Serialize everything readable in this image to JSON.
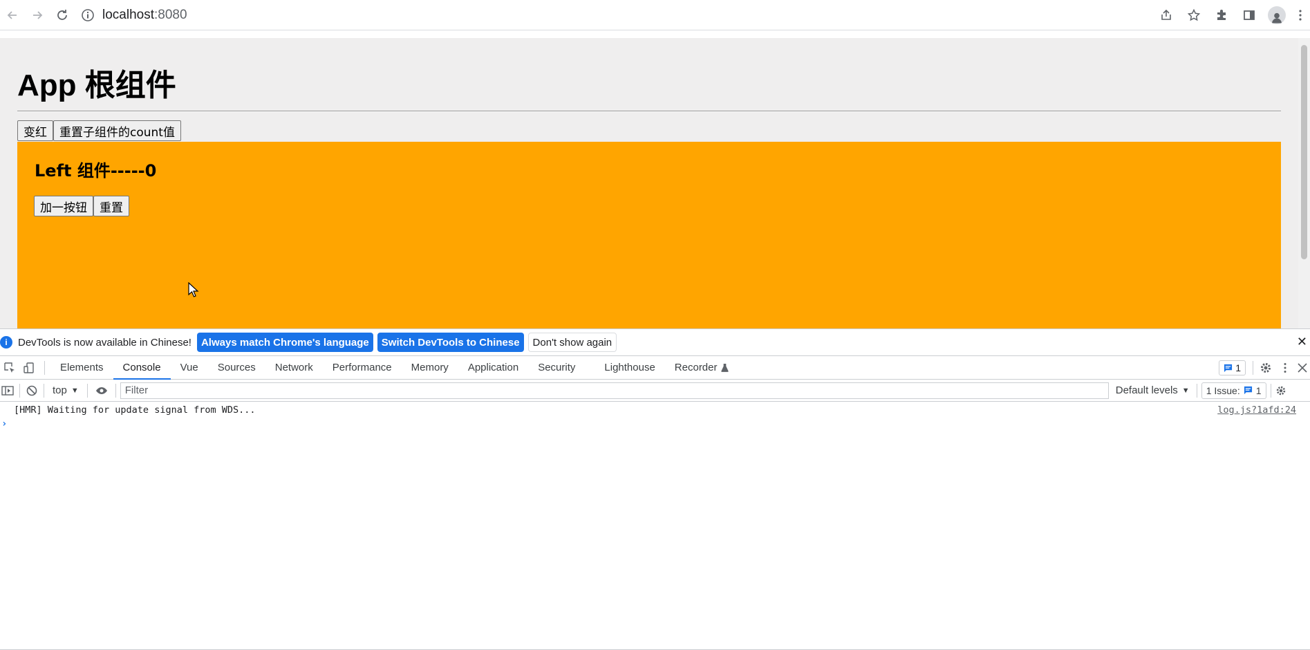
{
  "browser": {
    "url_host": "localhost",
    "url_port": ":8080"
  },
  "page": {
    "app_title": "App 根组件",
    "btn_red": "变红",
    "btn_reset_child": "重置子组件的count值",
    "left_title": "Left 组件-----0",
    "btn_add": "加一按钮",
    "btn_reset": "重置"
  },
  "devtools": {
    "infobar": {
      "text": "DevTools is now available in Chinese!",
      "btn_match": "Always match Chrome's language",
      "btn_switch": "Switch DevTools to Chinese",
      "btn_dont_show": "Don't show again"
    },
    "tabs": [
      "Elements",
      "Console",
      "Vue",
      "Sources",
      "Network",
      "Performance",
      "Memory",
      "Application",
      "Security",
      "Lighthouse",
      "Recorder"
    ],
    "active_tab": "Console",
    "message_count": "1",
    "console": {
      "context": "top",
      "filter_placeholder": "Filter",
      "levels": "Default levels",
      "issues_label": "1 Issue:",
      "issues_count": "1",
      "log_message": "[HMR] Waiting for update signal from WDS...",
      "log_source": "log.js?1afd:24"
    }
  },
  "colors": {
    "left_bg": "#ffa500",
    "page_bg": "#efeeee",
    "accent": "#1a73e8"
  }
}
